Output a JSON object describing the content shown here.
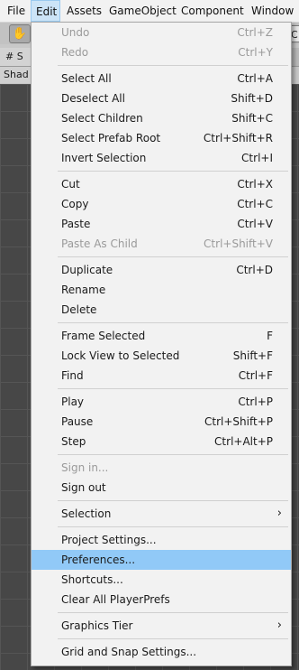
{
  "menubar": {
    "items": [
      {
        "label": "File"
      },
      {
        "label": "Edit"
      },
      {
        "label": "Assets"
      },
      {
        "label": "GameObject"
      },
      {
        "label": "Component"
      },
      {
        "label": "Window"
      }
    ]
  },
  "background": {
    "scene_tab": "# S",
    "shading_row": "Shad",
    "right_button": "C"
  },
  "edit_menu": {
    "undo": {
      "label": "Undo",
      "shortcut": "Ctrl+Z"
    },
    "redo": {
      "label": "Redo",
      "shortcut": "Ctrl+Y"
    },
    "select_all": {
      "label": "Select All",
      "shortcut": "Ctrl+A"
    },
    "deselect_all": {
      "label": "Deselect All",
      "shortcut": "Shift+D"
    },
    "select_children": {
      "label": "Select Children",
      "shortcut": "Shift+C"
    },
    "select_prefab_root": {
      "label": "Select Prefab Root",
      "shortcut": "Ctrl+Shift+R"
    },
    "invert_selection": {
      "label": "Invert Selection",
      "shortcut": "Ctrl+I"
    },
    "cut": {
      "label": "Cut",
      "shortcut": "Ctrl+X"
    },
    "copy": {
      "label": "Copy",
      "shortcut": "Ctrl+C"
    },
    "paste": {
      "label": "Paste",
      "shortcut": "Ctrl+V"
    },
    "paste_as_child": {
      "label": "Paste As Child",
      "shortcut": "Ctrl+Shift+V"
    },
    "duplicate": {
      "label": "Duplicate",
      "shortcut": "Ctrl+D"
    },
    "rename": {
      "label": "Rename"
    },
    "delete": {
      "label": "Delete"
    },
    "frame_selected": {
      "label": "Frame Selected",
      "shortcut": "F"
    },
    "lock_view": {
      "label": "Lock View to Selected",
      "shortcut": "Shift+F"
    },
    "find": {
      "label": "Find",
      "shortcut": "Ctrl+F"
    },
    "play": {
      "label": "Play",
      "shortcut": "Ctrl+P"
    },
    "pause": {
      "label": "Pause",
      "shortcut": "Ctrl+Shift+P"
    },
    "step": {
      "label": "Step",
      "shortcut": "Ctrl+Alt+P"
    },
    "sign_in": {
      "label": "Sign in..."
    },
    "sign_out": {
      "label": "Sign out"
    },
    "selection": {
      "label": "Selection",
      "arrow": "›"
    },
    "project_settings": {
      "label": "Project Settings..."
    },
    "preferences": {
      "label": "Preferences..."
    },
    "shortcuts": {
      "label": "Shortcuts..."
    },
    "clear_playerprefs": {
      "label": "Clear All PlayerPrefs"
    },
    "graphics_tier": {
      "label": "Graphics Tier",
      "arrow": "›"
    },
    "grid_snap": {
      "label": "Grid and Snap Settings..."
    }
  }
}
